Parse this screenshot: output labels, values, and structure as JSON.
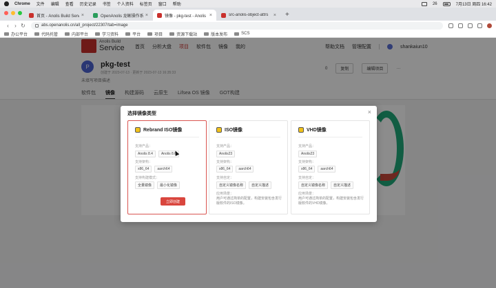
{
  "menubar": {
    "app": "Chrome",
    "items": [
      "文件",
      "编辑",
      "查看",
      "历史记录",
      "书签",
      "个人资料",
      "标签页",
      "窗口",
      "帮助"
    ],
    "battery": "26",
    "clock": "7月13日 周四 16:42"
  },
  "tabs": [
    {
      "label": "首页 - Anolis Build Service",
      "color": "#c9302c"
    },
    {
      "label": "OpenAnolis 龙蜥操作系统开源社区",
      "color": "#2a9d5c"
    },
    {
      "label": "镜像 - pkg-test - Anolis Build S",
      "color": "#c9302c"
    },
    {
      "label": "src-anolis-object-attrs",
      "color": "#c9302c"
    }
  ],
  "address": {
    "url": "abs.openanolis.cn/all_project/22307/tab=image"
  },
  "bookmarks": [
    "办公平台",
    "代码托管",
    "内部平台",
    "学习资料",
    "平台",
    "项目",
    "资源下载站",
    "版本发布",
    "SCS"
  ],
  "site": {
    "brand_top": "Anolis Build",
    "brand_main": "Service",
    "nav": [
      "首页",
      "分析大盘",
      "项目",
      "软件包",
      "镜像",
      "我的"
    ],
    "nav_current": "项目",
    "help": "帮助文档",
    "admin": "管理配置",
    "user": "shankaiun10"
  },
  "project": {
    "initial": "P",
    "name": "pkg-test",
    "meta": "创建于 2023-07-13 · 更新于 2023-07-13 16:35:33",
    "desc": "未填写项目描述",
    "star_count": "0",
    "copy": "复制",
    "edit": "编辑项目",
    "more": "···"
  },
  "subtabs": [
    "软件包",
    "镜像",
    "构建源码",
    "云原生",
    "Lifsea OS 镜像",
    "GOT构建"
  ],
  "subtab_current": "镜像",
  "dialog": {
    "title": "选择镜像类型",
    "close": "×",
    "cards": [
      {
        "title": "Rebrand ISO镜像",
        "products_label": "支持产品：",
        "products": [
          "Anolis 8.4",
          "Anolis 8.6"
        ],
        "arch_label": "支持架构：",
        "archs": [
          "x86_64",
          "aarch64"
        ],
        "mode_label": "支持构建模式：",
        "modes": [
          "全量镜像",
          "最小化镜像"
        ],
        "note_label": "",
        "note": "",
        "button": "立即创建",
        "selected": true
      },
      {
        "title": "ISO镜像",
        "products_label": "支持产品：",
        "products": [
          "Anolis23"
        ],
        "arch_label": "支持架构：",
        "archs": [
          "x86_64",
          "aarch64"
        ],
        "mode_label": "支持自定：",
        "modes": [
          "自定义镜像名称",
          "自定义描述"
        ],
        "note_label": "应用场景：",
        "note": "用户可通过简单的配置，构建安装包含发行版软件的ISO镜像。",
        "button": "",
        "selected": false
      },
      {
        "title": "VHD镜像",
        "products_label": "支持产品：",
        "products": [
          "Anolis23"
        ],
        "arch_label": "支持架构：",
        "archs": [
          "x86_64",
          "aarch64"
        ],
        "mode_label": "支持自定：",
        "modes": [
          "自定义镜像名称",
          "自定义描述"
        ],
        "note_label": "应用场景：",
        "note": "用户可通过简单的配置，构建安装包含发行版软件的VHD镜像。",
        "button": "",
        "selected": false
      }
    ]
  }
}
